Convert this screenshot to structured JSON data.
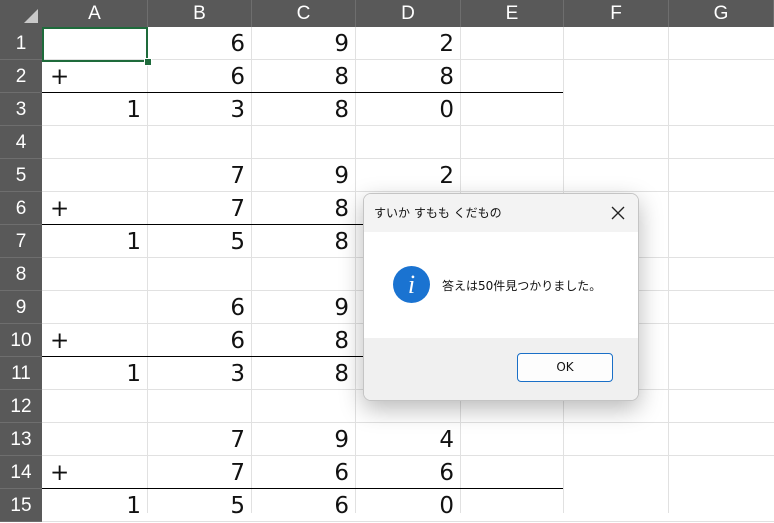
{
  "sheet": {
    "column_headers": [
      "A",
      "B",
      "C",
      "D",
      "E",
      "F",
      "G"
    ],
    "row_headers": [
      "1",
      "2",
      "3",
      "4",
      "5",
      "6",
      "7",
      "8",
      "9",
      "10",
      "11",
      "12",
      "13",
      "14",
      "15"
    ],
    "rows": [
      [
        "",
        "6",
        "9",
        "2"
      ],
      [
        "+",
        "6",
        "8",
        "8"
      ],
      [
        "1",
        "3",
        "8",
        "0"
      ],
      [
        "",
        "",
        "",
        ""
      ],
      [
        "",
        "7",
        "9",
        "2"
      ],
      [
        "+",
        "7",
        "8",
        ""
      ],
      [
        "1",
        "5",
        "8",
        ""
      ],
      [
        "",
        "",
        "",
        ""
      ],
      [
        "",
        "6",
        "9",
        ""
      ],
      [
        "+",
        "6",
        "8",
        ""
      ],
      [
        "1",
        "3",
        "8",
        ""
      ],
      [
        "",
        "",
        "",
        ""
      ],
      [
        "",
        "7",
        "9",
        "4"
      ],
      [
        "+",
        "7",
        "6",
        "6"
      ],
      [
        "1",
        "5",
        "6",
        "0"
      ]
    ],
    "colors": {
      "header_bg": "#595959",
      "header_text": "#ffffff",
      "selection_border": "#1e6b3b",
      "gridline": "#e1e1e1"
    }
  },
  "dialog": {
    "title": "すいか すもも くだもの",
    "icon": "info-icon",
    "icon_glyph": "i",
    "message": "答えは50件見つかりました。",
    "ok_label": "OK",
    "close_glyph": "✕",
    "colors": {
      "icon": "#1a73d1",
      "ok_border": "#1a6fc7"
    }
  }
}
